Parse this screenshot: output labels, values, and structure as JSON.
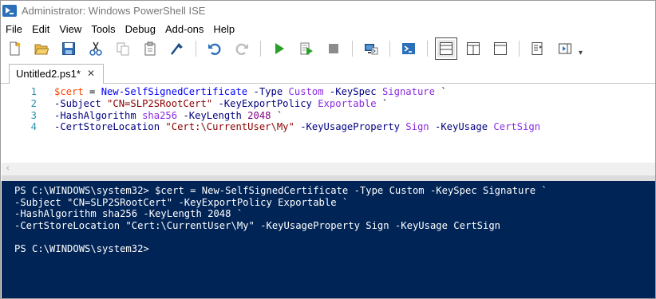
{
  "window": {
    "title": "Administrator: Windows PowerShell ISE"
  },
  "menu": [
    "File",
    "Edit",
    "View",
    "Tools",
    "Debug",
    "Add-ons",
    "Help"
  ],
  "toolbar": {
    "buttons": [
      {
        "name": "new-file-icon"
      },
      {
        "name": "open-file-icon"
      },
      {
        "name": "save-icon"
      },
      {
        "name": "cut-icon"
      },
      {
        "name": "copy-icon"
      },
      {
        "name": "paste-icon"
      },
      {
        "name": "clear-console-icon"
      },
      {
        "name": "undo-icon"
      },
      {
        "name": "redo-icon"
      },
      {
        "name": "run-script-icon"
      },
      {
        "name": "run-selection-icon"
      },
      {
        "name": "stop-icon"
      },
      {
        "name": "remote-powershell-tab-icon"
      },
      {
        "name": "start-powershell-exe-icon"
      },
      {
        "name": "show-script-pane-top-icon"
      },
      {
        "name": "show-script-pane-right-icon"
      },
      {
        "name": "show-script-pane-maximized-icon"
      },
      {
        "name": "show-command-window-icon"
      },
      {
        "name": "show-command-addon-icon"
      }
    ],
    "overflow": "▾"
  },
  "tabs": [
    {
      "label": "Untitled2.ps1*",
      "close": "✕"
    }
  ],
  "editor": {
    "line_numbers": [
      "1",
      "2",
      "3",
      "4"
    ],
    "lines": [
      [
        {
          "t": "$cert",
          "c": "v"
        },
        {
          "t": " = ",
          "c": "t"
        },
        {
          "t": "New-SelfSignedCertificate",
          "c": "c"
        },
        {
          "t": " ",
          "c": "t"
        },
        {
          "t": "-Type",
          "c": "p"
        },
        {
          "t": " ",
          "c": "t"
        },
        {
          "t": "Custom",
          "c": "a"
        },
        {
          "t": " ",
          "c": "t"
        },
        {
          "t": "-KeySpec",
          "c": "p"
        },
        {
          "t": " ",
          "c": "t"
        },
        {
          "t": "Signature",
          "c": "a"
        },
        {
          "t": " `",
          "c": "t"
        }
      ],
      [
        {
          "t": "-Subject",
          "c": "p"
        },
        {
          "t": " ",
          "c": "t"
        },
        {
          "t": "\"CN=SLP2SRootCert\"",
          "c": "s"
        },
        {
          "t": " ",
          "c": "t"
        },
        {
          "t": "-KeyExportPolicy",
          "c": "p"
        },
        {
          "t": " ",
          "c": "t"
        },
        {
          "t": "Exportable",
          "c": "a"
        },
        {
          "t": " `",
          "c": "t"
        }
      ],
      [
        {
          "t": "-HashAlgorithm",
          "c": "p"
        },
        {
          "t": " ",
          "c": "t"
        },
        {
          "t": "sha256",
          "c": "a"
        },
        {
          "t": " ",
          "c": "t"
        },
        {
          "t": "-KeyLength",
          "c": "p"
        },
        {
          "t": " ",
          "c": "t"
        },
        {
          "t": "2048",
          "c": "n"
        },
        {
          "t": " `",
          "c": "t"
        }
      ],
      [
        {
          "t": "-CertStoreLocation",
          "c": "p"
        },
        {
          "t": " ",
          "c": "t"
        },
        {
          "t": "\"Cert:\\CurrentUser\\My\"",
          "c": "s"
        },
        {
          "t": " ",
          "c": "t"
        },
        {
          "t": "-KeyUsageProperty",
          "c": "p"
        },
        {
          "t": " ",
          "c": "t"
        },
        {
          "t": "Sign",
          "c": "a"
        },
        {
          "t": " ",
          "c": "t"
        },
        {
          "t": "-KeyUsage",
          "c": "p"
        },
        {
          "t": " ",
          "c": "t"
        },
        {
          "t": "CertSign",
          "c": "a"
        }
      ]
    ]
  },
  "console": {
    "lines": [
      "PS C:\\WINDOWS\\system32> $cert = New-SelfSignedCertificate -Type Custom -KeySpec Signature `",
      "-Subject \"CN=SLP2SRootCert\" -KeyExportPolicy Exportable `",
      "-HashAlgorithm sha256 -KeyLength 2048 `",
      "-CertStoreLocation \"Cert:\\CurrentUser\\My\" -KeyUsageProperty Sign -KeyUsage CertSign",
      "",
      "PS C:\\WINDOWS\\system32>"
    ]
  },
  "colors": {
    "console_bg": "#012456",
    "variable": "#ff4500",
    "command": "#0000ff",
    "parameter": "#000080",
    "argument": "#8a2be2",
    "string": "#8b0000",
    "number": "#800080",
    "line_number": "#2b91af"
  }
}
